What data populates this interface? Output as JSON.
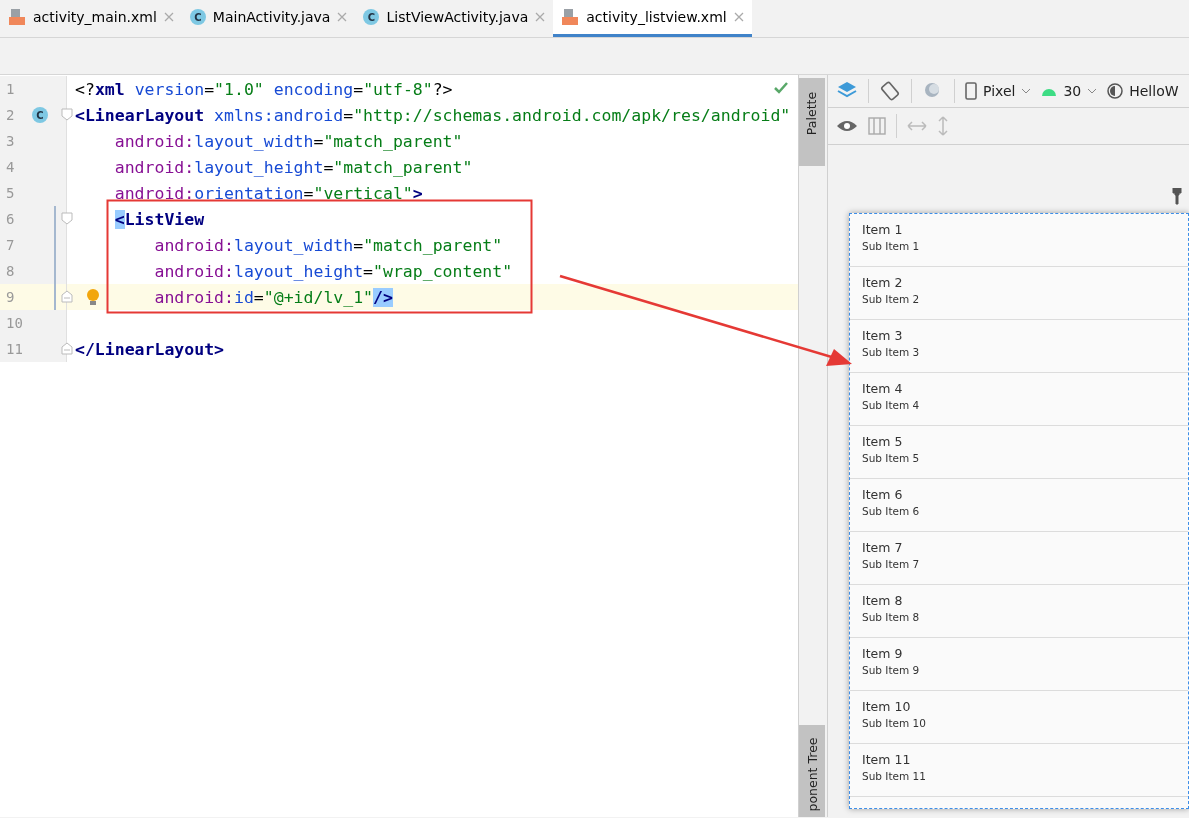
{
  "tabs": [
    {
      "label": "activity_main.xml",
      "kind": "xml",
      "selected": false
    },
    {
      "label": "MainActivity.java",
      "kind": "class",
      "badge": "C",
      "selected": false
    },
    {
      "label": "ListViewActivity.java",
      "kind": "class",
      "badge": "C",
      "selected": false
    },
    {
      "label": "activity_listview.xml",
      "kind": "xml",
      "selected": true
    }
  ],
  "editor": {
    "lines": [
      {
        "number": "1",
        "tokens": [
          {
            "kind": "punct",
            "text": "<?"
          },
          {
            "kind": "tag",
            "text": "xml"
          },
          {
            "kind": "attr",
            "text": " version"
          },
          {
            "kind": "punct",
            "text": "="
          },
          {
            "kind": "val",
            "text": "\"1.0\""
          },
          {
            "kind": "attr",
            "text": " encoding"
          },
          {
            "kind": "punct",
            "text": "="
          },
          {
            "kind": "val",
            "text": "\"utf-8\""
          },
          {
            "kind": "punct",
            "text": "?>"
          }
        ]
      },
      {
        "number": "2",
        "badge": "C",
        "fold_start": true,
        "tokens": [
          {
            "kind": "tag",
            "text": "<LinearLayout"
          },
          {
            "kind": "attr",
            "text": " xmlns:android"
          },
          {
            "kind": "punct",
            "text": "="
          },
          {
            "kind": "val",
            "text": "\"http://schemas.android.com/apk/res/android\""
          }
        ]
      },
      {
        "number": "3",
        "tokens": [
          {
            "kind": "ns",
            "text": "    android:"
          },
          {
            "kind": "attr",
            "text": "layout_width"
          },
          {
            "kind": "punct",
            "text": "="
          },
          {
            "kind": "val",
            "text": "\"match_parent\""
          }
        ]
      },
      {
        "number": "4",
        "tokens": [
          {
            "kind": "ns",
            "text": "    android:"
          },
          {
            "kind": "attr",
            "text": "layout_height"
          },
          {
            "kind": "punct",
            "text": "="
          },
          {
            "kind": "val",
            "text": "\"match_parent\""
          }
        ]
      },
      {
        "number": "5",
        "tokens": [
          {
            "kind": "ns",
            "text": "    android:"
          },
          {
            "kind": "attr",
            "text": "orientation"
          },
          {
            "kind": "punct",
            "text": "="
          },
          {
            "kind": "val",
            "text": "\"vertical\""
          },
          {
            "kind": "tag",
            "text": ">"
          }
        ]
      },
      {
        "number": "6",
        "fold_start": true,
        "modified": true,
        "tokens": [
          {
            "kind": "tag",
            "text": "    <",
            "match": true
          },
          {
            "kind": "tag",
            "text": "ListView"
          }
        ]
      },
      {
        "number": "7",
        "modified": true,
        "tokens": [
          {
            "kind": "ns",
            "text": "        android:"
          },
          {
            "kind": "attr",
            "text": "layout_width"
          },
          {
            "kind": "punct",
            "text": "="
          },
          {
            "kind": "val",
            "text": "\"match_parent\""
          }
        ]
      },
      {
        "number": "8",
        "modified": true,
        "tokens": [
          {
            "kind": "ns",
            "text": "        android:"
          },
          {
            "kind": "attr",
            "text": "layout_height"
          },
          {
            "kind": "punct",
            "text": "="
          },
          {
            "kind": "val",
            "text": "\"wrap_content\""
          }
        ]
      },
      {
        "number": "9",
        "fold_end": true,
        "modified": true,
        "bulb": true,
        "current": true,
        "tokens": [
          {
            "kind": "ns",
            "text": "        android:"
          },
          {
            "kind": "attr",
            "text": "id"
          },
          {
            "kind": "punct",
            "text": "="
          },
          {
            "kind": "val",
            "text": "\"@+id/lv_1\""
          },
          {
            "kind": "tag",
            "text": "/>",
            "match": true
          }
        ]
      },
      {
        "number": "10"
      },
      {
        "number": "11",
        "fold_end": true,
        "tokens": [
          {
            "kind": "tag",
            "text": "</LinearLayout>"
          }
        ]
      }
    ]
  },
  "design": {
    "side_tabs": [
      {
        "label": "Palette",
        "kind": "top"
      },
      {
        "label": "ponent Tree",
        "kind": "bottom"
      }
    ],
    "device": "Pixel",
    "api": "30",
    "theme": "HelloW",
    "list_items": [
      {
        "title": "Item 1",
        "subtitle": "Sub Item 1"
      },
      {
        "title": "Item 2",
        "subtitle": "Sub Item 2"
      },
      {
        "title": "Item 3",
        "subtitle": "Sub Item 3"
      },
      {
        "title": "Item 4",
        "subtitle": "Sub Item 4"
      },
      {
        "title": "Item 5",
        "subtitle": "Sub Item 5"
      },
      {
        "title": "Item 6",
        "subtitle": "Sub Item 6"
      },
      {
        "title": "Item 7",
        "subtitle": "Sub Item 7"
      },
      {
        "title": "Item 8",
        "subtitle": "Sub Item 8"
      },
      {
        "title": "Item 9",
        "subtitle": "Sub Item 9"
      },
      {
        "title": "Item 10",
        "subtitle": "Sub Item 10"
      },
      {
        "title": "Item 11",
        "subtitle": "Sub Item 11"
      }
    ]
  }
}
